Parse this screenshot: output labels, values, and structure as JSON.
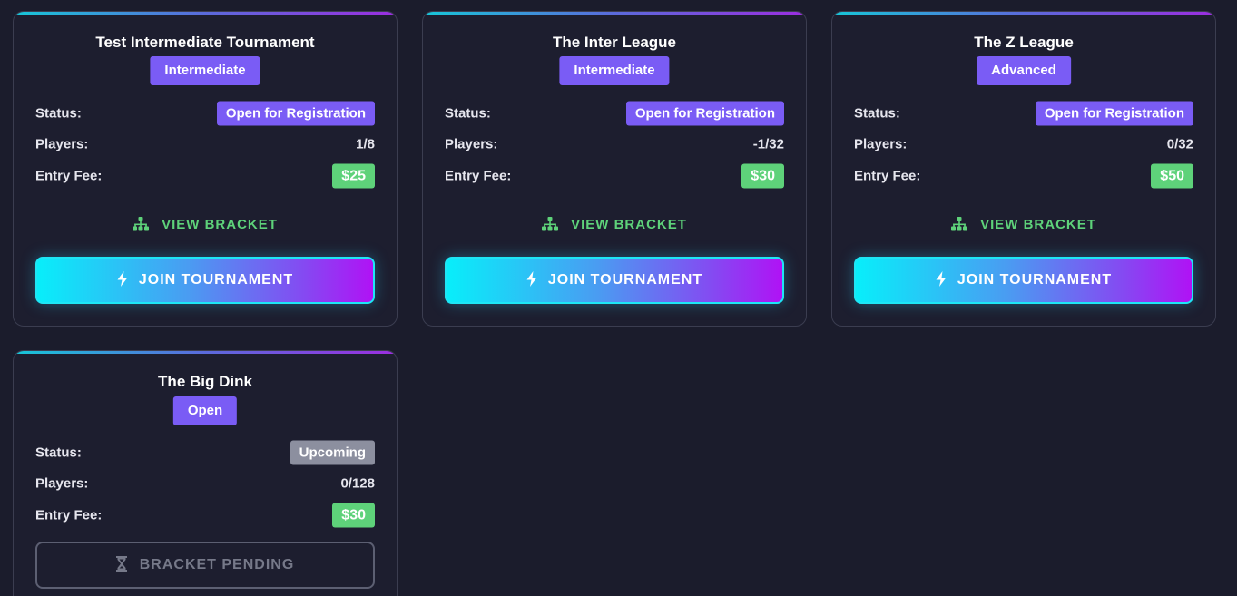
{
  "labels": {
    "status": "Status:",
    "players": "Players:",
    "entry_fee": "Entry Fee:",
    "view_bracket": "VIEW BRACKET",
    "join_tournament": "JOIN TOURNAMENT",
    "bracket_pending": "BRACKET PENDING"
  },
  "icons": {
    "bracket": "sitemap-icon",
    "join": "bolt-icon",
    "pending": "hourglass-icon"
  },
  "colors": {
    "background": "#1b1c2c",
    "card": "#1d1e2f",
    "level_badge": "#7a5cf5",
    "status_open": "#7a5cf5",
    "status_upcoming": "#8c8f9f",
    "fee": "#5ed27a",
    "view_bracket": "#5ed27a",
    "join_gradient_start": "#08eefa",
    "join_gradient_end": "#b012f5"
  },
  "tournaments": [
    {
      "name": "Test Intermediate Tournament",
      "level": "Intermediate",
      "status": "Open for Registration",
      "players": "1/8",
      "fee": "$25"
    },
    {
      "name": "The Inter League",
      "level": "Intermediate",
      "status": "Open for Registration",
      "players": "-1/32",
      "fee": "$30"
    },
    {
      "name": "The Z League",
      "level": "Advanced",
      "status": "Open for Registration",
      "players": "0/32",
      "fee": "$50"
    },
    {
      "name": "The Big Dink",
      "level": "Open",
      "status": "Upcoming",
      "players": "0/128",
      "fee": "$30"
    }
  ]
}
